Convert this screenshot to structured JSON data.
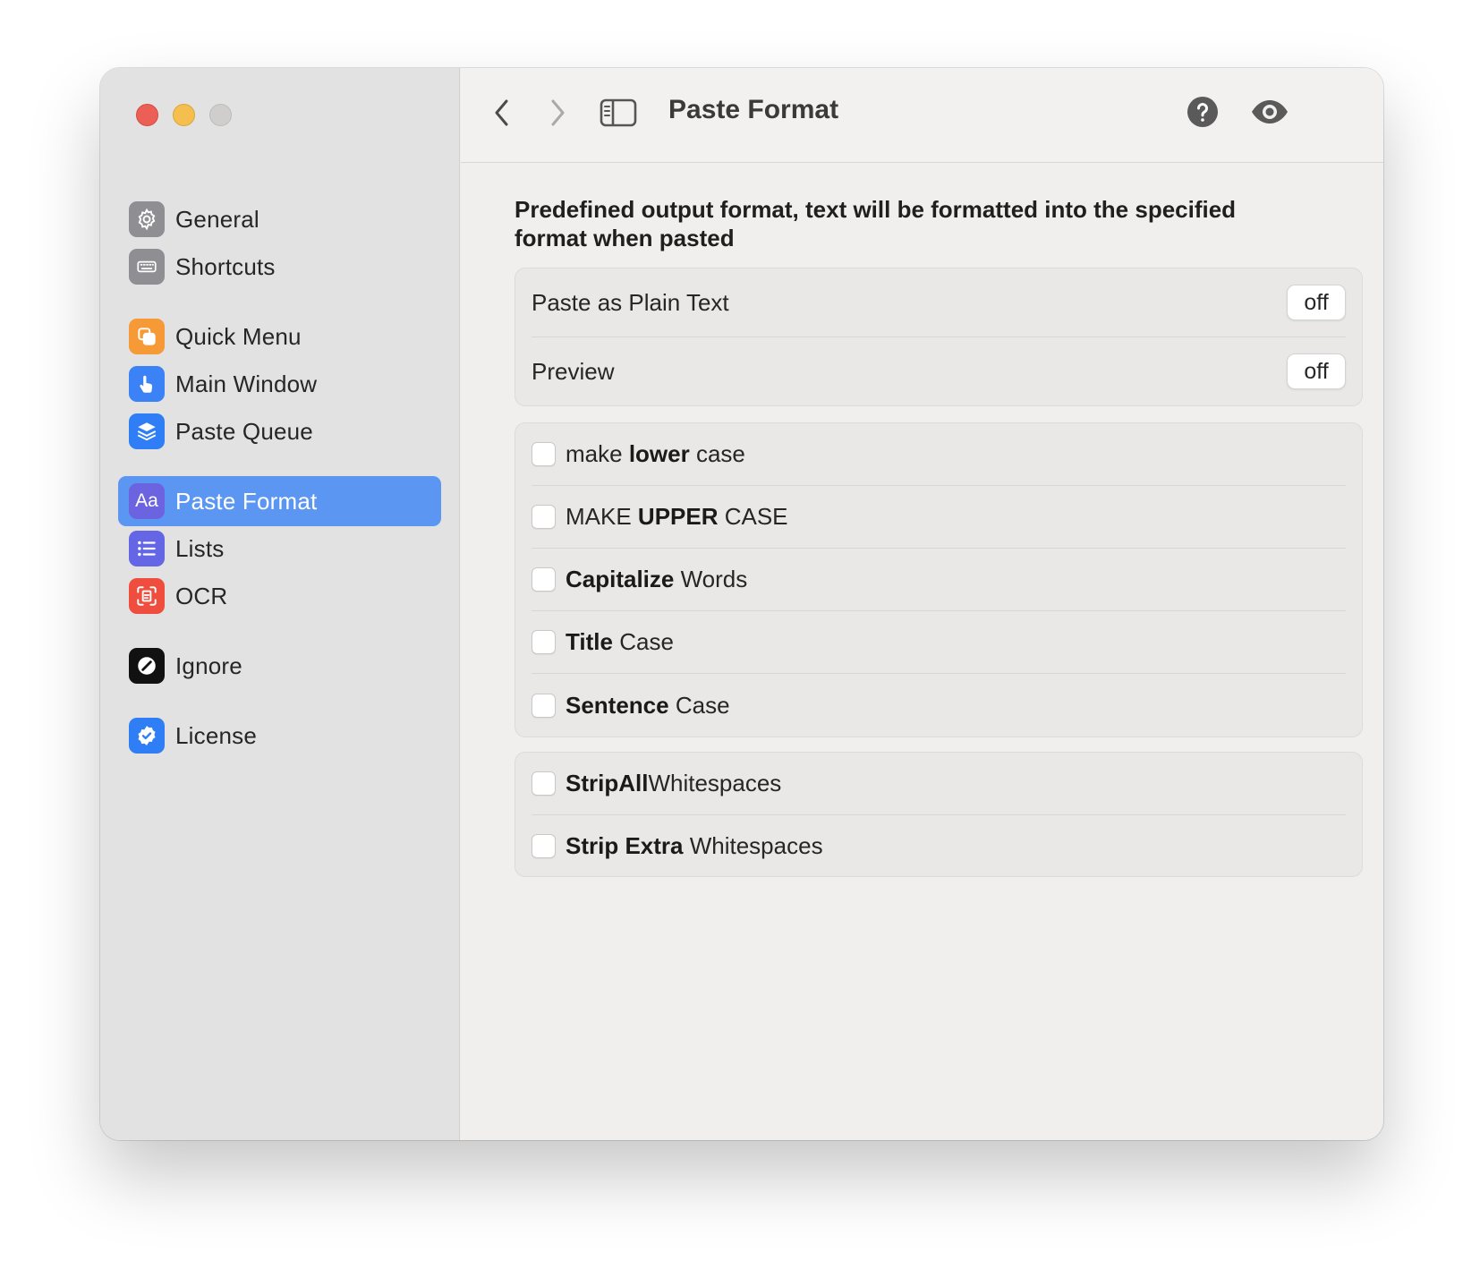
{
  "window": {
    "title": "Paste Format",
    "traffic_lights": {
      "close": "#ec5f57",
      "minimize": "#f4bf4f",
      "zoom": "#cfcecd"
    }
  },
  "sidebar": {
    "items": [
      {
        "label": "General",
        "icon": "gear-icon",
        "color": "#8e8e93"
      },
      {
        "label": "Shortcuts",
        "icon": "keyboard-icon",
        "color": "#8e8e93"
      },
      {
        "label": "Quick Menu",
        "icon": "stacked-squares-icon",
        "color": "#f59a36"
      },
      {
        "label": "Main Window",
        "icon": "hand-pointer-icon",
        "color": "#3b82f6"
      },
      {
        "label": "Paste Queue",
        "icon": "layers-icon",
        "color": "#2f7ef5"
      },
      {
        "label": "Paste Format",
        "icon": "text-format-icon",
        "icon_text": "Aa",
        "color": "#6c63e0",
        "selected": true
      },
      {
        "label": "Lists",
        "icon": "list-icon",
        "color": "#6466e6"
      },
      {
        "label": "OCR",
        "icon": "document-scan-icon",
        "color": "#ef4e3f"
      },
      {
        "label": "Ignore",
        "icon": "ignore-icon",
        "color": "#111111"
      },
      {
        "label": "License",
        "icon": "verified-badge-icon",
        "color": "#2f7ef5"
      }
    ],
    "selected_color": "#5b96f3"
  },
  "toolbar": {
    "back": "chevron-left-icon",
    "forward": "chevron-right-icon",
    "sidebar_toggle": "sidebar-icon",
    "title": "Paste Format",
    "help": "question-circle-icon",
    "preview": "eye-icon"
  },
  "content": {
    "description": "Predefined output format, text will be formatted into the specified format when pasted",
    "toggles": [
      {
        "label": "Paste as Plain Text",
        "value": "off"
      },
      {
        "label": "Preview",
        "value": "off"
      }
    ],
    "case_options": [
      {
        "parts": [
          "make ",
          "lower",
          " case"
        ],
        "checked": false
      },
      {
        "parts": [
          "MAKE ",
          "UPPER",
          " CASE"
        ],
        "checked": false
      },
      {
        "parts": [
          "",
          "Capitalize",
          " Words"
        ],
        "checked": false
      },
      {
        "parts": [
          "",
          "Title",
          " Case"
        ],
        "checked": false
      },
      {
        "parts": [
          "",
          "Sentence",
          " Case"
        ],
        "checked": false
      }
    ],
    "whitespace_options": [
      {
        "parts": [
          "",
          "StripAll",
          "Whitespaces"
        ],
        "checked": false
      },
      {
        "parts": [
          "",
          "Strip Extra",
          " Whitespaces"
        ],
        "checked": false
      }
    ]
  }
}
